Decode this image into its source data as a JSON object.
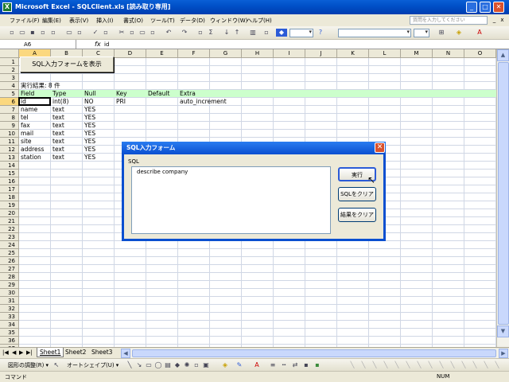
{
  "window": {
    "title": "Microsoft Excel - SQLClient.xls  [読み取り専用]",
    "app_icon": "X",
    "minimize": "_",
    "maximize": "□",
    "close": "✕"
  },
  "menu": {
    "items": [
      "ファイル(F)",
      "編集(E)",
      "表示(V)",
      "挿入(I)",
      "書式(O)",
      "ツール(T)",
      "データ(D)",
      "ウィンドウ(W)",
      "ヘルプ(H)"
    ],
    "help_placeholder": "質問を入力してください"
  },
  "formula_bar": {
    "name_box": "A6",
    "fx": "fx",
    "value": "id"
  },
  "columns": [
    "A",
    "B",
    "C",
    "D",
    "E",
    "F",
    "G",
    "H",
    "I",
    "J",
    "K",
    "L",
    "M",
    "N",
    "O"
  ],
  "rows": [
    "1",
    "2",
    "3",
    "4",
    "5",
    "6",
    "7",
    "8",
    "9",
    "10",
    "11",
    "12",
    "13",
    "14",
    "15",
    "16",
    "17",
    "18",
    "19",
    "20",
    "21",
    "22",
    "23",
    "24",
    "25",
    "26",
    "27",
    "28",
    "29",
    "30",
    "31",
    "32",
    "33",
    "34",
    "35",
    "36",
    "37"
  ],
  "sheet_button_label": "SQL入力フォームを表示",
  "result_label": "実行結果: 8 件",
  "table": {
    "headers": [
      "Field",
      "Type",
      "Null",
      "Key",
      "Default",
      "Extra"
    ],
    "rows": [
      [
        "id",
        "int(8)",
        "NO",
        "PRI",
        "",
        "auto_increment"
      ],
      [
        "name",
        "text",
        "YES",
        "",
        "",
        ""
      ],
      [
        "tel",
        "text",
        "YES",
        "",
        "",
        ""
      ],
      [
        "fax",
        "text",
        "YES",
        "",
        "",
        ""
      ],
      [
        "mail",
        "text",
        "YES",
        "",
        "",
        ""
      ],
      [
        "site",
        "text",
        "YES",
        "",
        "",
        ""
      ],
      [
        "address",
        "text",
        "YES",
        "",
        "",
        ""
      ],
      [
        "station",
        "text",
        "YES",
        "",
        "",
        ""
      ]
    ]
  },
  "sheets": {
    "nav": [
      "|◀",
      "◀",
      "▶",
      "▶|"
    ],
    "tabs": [
      "Sheet1",
      "Sheet2",
      "Sheet3"
    ]
  },
  "draw_toolbar": {
    "draw_label": "図形の調整(R) ▾",
    "autoshape_label": "オートシェイプ(U) ▾"
  },
  "status": {
    "left": "コマンド",
    "num": "NUM"
  },
  "dialog": {
    "title": "SQL入力フォーム",
    "sql_label": "SQL",
    "sql_text": "describe company",
    "buttons": [
      "実行",
      "SQLをクリア",
      "結果をクリア"
    ]
  },
  "colors": {
    "header_band": "#ccffcc",
    "selection_header": "#fbd87f",
    "titlebar": "#0a5fd6"
  }
}
